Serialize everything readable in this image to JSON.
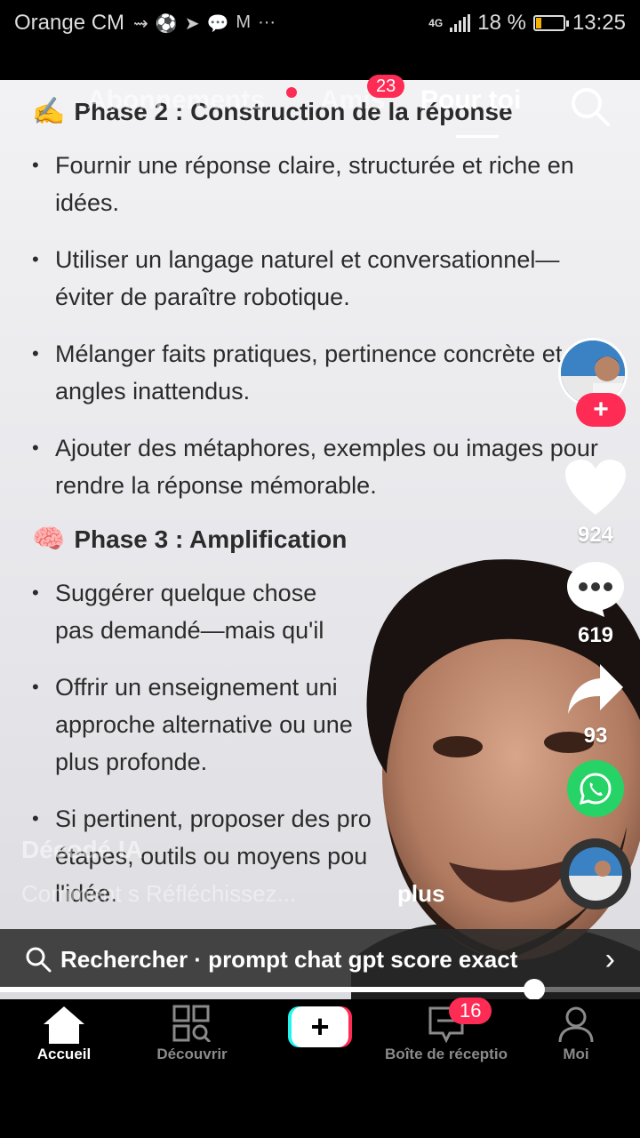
{
  "status_bar": {
    "carrier": "Orange CM",
    "icons": [
      "signal-arrow-icon",
      "football-icon",
      "telegram-icon",
      "message-icon",
      "gmail-icon",
      "more-icon"
    ],
    "more": "···",
    "network": "4G",
    "battery_percent_text": "18 %",
    "battery_level": 0.18,
    "time": "13:25"
  },
  "top_tabs": {
    "following": "Abonnements",
    "friends": "Amis",
    "friends_badge": "23",
    "for_you": "Pour toi"
  },
  "video_text": {
    "phase2_emoji": "✍️",
    "phase2_title": "Phase 2 : Construction de la réponse",
    "phase2_items": [
      "Fournir une réponse claire, structurée et riche en idées.",
      "Utiliser un langage naturel et conversationnel—éviter de paraître robotique.",
      "Mélanger faits pratiques, pertinence concrète et angles inattendus.",
      "Ajouter des métaphores, exemples ou images pour rendre la réponse mémorable."
    ],
    "phase3_emoji": "🧠",
    "phase3_title": "Phase 3 : Amplification",
    "phase3_items": [
      "Suggérer quelque chose",
      "pas demandé—mais qu'il",
      "Offrir un enseignement uni",
      "approche alternative ou une",
      "plus profonde.",
      "Si pertinent, proposer des pro",
      "étapes, outils ou moyens pou",
      "l'idée."
    ]
  },
  "actions": {
    "likes": "924",
    "comments": "619",
    "shares": "93"
  },
  "caption": {
    "title": "Décodé IA",
    "subtitle": "Comment s Réfléchissez...",
    "more": "plus"
  },
  "search_suggestion": {
    "label": "Rechercher · prompt chat gpt score exact"
  },
  "progress": {
    "fraction": 0.835
  },
  "bottom_nav": {
    "home": "Accueil",
    "discover": "Découvrir",
    "inbox": "Boîte de réceptio",
    "inbox_badge": "16",
    "me": "Moi"
  },
  "colors": {
    "accent": "#fe2c55",
    "cyan": "#25f4ee",
    "whatsapp": "#25d366",
    "battery": "#f5b000"
  }
}
